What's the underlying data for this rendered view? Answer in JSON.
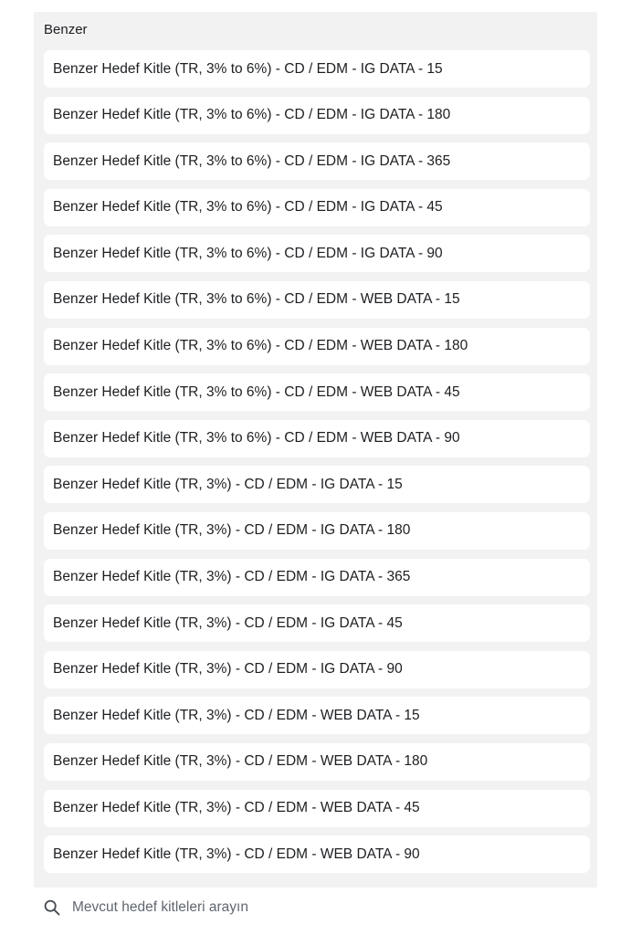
{
  "section": {
    "title": "Benzer"
  },
  "items": [
    "Benzer Hedef Kitle (TR, 3% to 6%) - CD / EDM - IG DATA - 15",
    "Benzer Hedef Kitle (TR, 3% to 6%) - CD / EDM - IG DATA - 180",
    "Benzer Hedef Kitle (TR, 3% to 6%) - CD / EDM - IG DATA - 365",
    "Benzer Hedef Kitle (TR, 3% to 6%) - CD / EDM - IG DATA - 45",
    "Benzer Hedef Kitle (TR, 3% to 6%) - CD / EDM - IG DATA - 90",
    "Benzer Hedef Kitle (TR, 3% to 6%) - CD / EDM - WEB DATA - 15",
    "Benzer Hedef Kitle (TR, 3% to 6%) - CD / EDM - WEB DATA - 180",
    "Benzer Hedef Kitle (TR, 3% to 6%) - CD / EDM - WEB DATA - 45",
    "Benzer Hedef Kitle (TR, 3% to 6%) - CD / EDM - WEB DATA - 90",
    "Benzer Hedef Kitle (TR, 3%) - CD / EDM - IG DATA - 15",
    "Benzer Hedef Kitle (TR, 3%) - CD / EDM - IG DATA - 180",
    "Benzer Hedef Kitle (TR, 3%) - CD / EDM - IG DATA - 365",
    "Benzer Hedef Kitle (TR, 3%) - CD / EDM - IG DATA - 45",
    "Benzer Hedef Kitle (TR, 3%) - CD / EDM - IG DATA - 90",
    "Benzer Hedef Kitle (TR, 3%) - CD / EDM - WEB DATA - 15",
    "Benzer Hedef Kitle (TR, 3%) - CD / EDM - WEB DATA - 180",
    "Benzer Hedef Kitle (TR, 3%) - CD / EDM - WEB DATA - 45",
    "Benzer Hedef Kitle (TR, 3%) - CD / EDM - WEB DATA - 90"
  ],
  "search": {
    "placeholder": "Mevcut hedef kitleleri arayın",
    "value": "",
    "icon": "search-icon"
  },
  "colors": {
    "panel_background": "#f2f2f3",
    "item_background": "#ffffff",
    "text": "#1c1e21",
    "placeholder": "#606770"
  }
}
